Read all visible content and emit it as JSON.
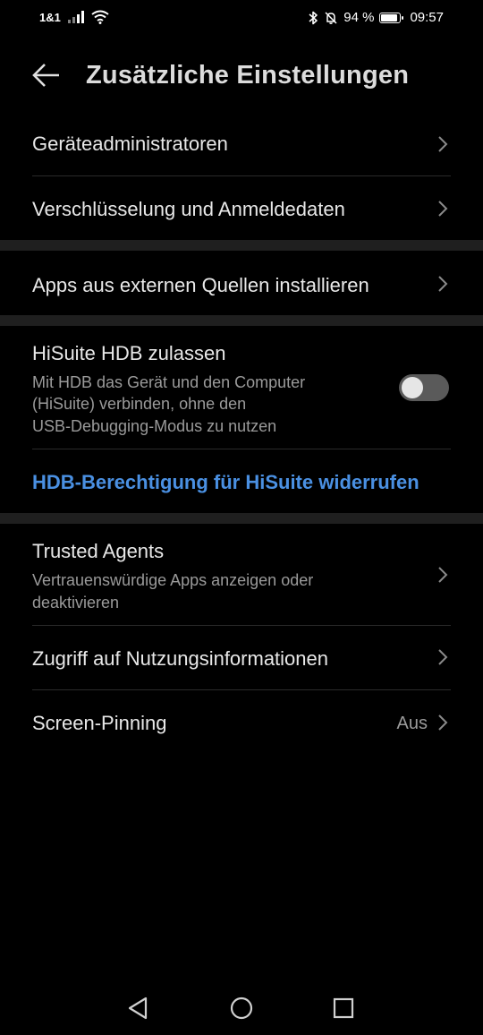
{
  "status_bar": {
    "carrier": "1&1",
    "battery_text": "94 %",
    "battery_level": 0.94,
    "time": "09:57"
  },
  "header": {
    "title": "Zusätzliche Einstellungen"
  },
  "items": {
    "device_admins": {
      "label": "Geräteadministratoren"
    },
    "encryption": {
      "label": "Verschlüsselung und Anmeldedaten"
    },
    "external_sources": {
      "label": "Apps aus externen Quellen installieren"
    },
    "hisuite_hdb": {
      "label": "HiSuite HDB zulassen",
      "description_lines": [
        "Mit HDB das Gerät und den Computer",
        "(HiSuite) verbinden, ohne den",
        "USB-Debugging-Modus zu nutzen"
      ],
      "toggle_on": false
    },
    "revoke_hdb": {
      "label": "HDB-Berechtigung für HiSuite widerrufen"
    },
    "trusted_agents": {
      "label": "Trusted Agents",
      "description_lines": [
        "Vertrauenswürdige Apps anzeigen oder",
        "deaktivieren"
      ]
    },
    "usage_access": {
      "label": "Zugriff auf Nutzungsinformationen"
    },
    "screen_pinning": {
      "label": "Screen-Pinning",
      "value": "Aus"
    }
  },
  "colors": {
    "background": "#000000",
    "accent": "#4a90e2",
    "section_gap": "#1f1f1f",
    "divider": "#2a2a2a"
  },
  "icons": [
    "back-arrow-icon",
    "chevron-right-icon",
    "wifi-icon",
    "signal-icon",
    "bluetooth-icon",
    "bell-off-icon",
    "battery-icon",
    "nav-back-icon",
    "nav-home-icon",
    "nav-recents-icon"
  ]
}
